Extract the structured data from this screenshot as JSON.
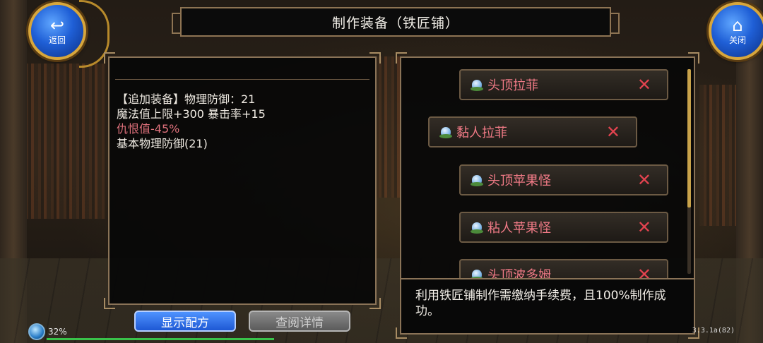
{
  "header": {
    "back_label": "返回",
    "close_label": "关闭",
    "title": "制作装备（铁匠铺）"
  },
  "equipment_stats": {
    "line1": "【追加装备】物理防御：21",
    "line2": "魔法值上限+300 暴击率+15",
    "line3": "仇恨值-45%",
    "line4": "基本物理防御(21)"
  },
  "materials": [
    {
      "name": "头顶拉菲",
      "remove": "✕"
    },
    {
      "name": "黏人拉菲",
      "remove": "✕"
    },
    {
      "name": "头顶苹果怪",
      "remove": "✕"
    },
    {
      "name": "粘人苹果怪",
      "remove": "✕"
    },
    {
      "name": "头顶波多姆",
      "remove": "✕"
    }
  ],
  "note": "利用铁匠铺制作需缴纳手续费，且100%制作成功。",
  "buttons": {
    "show_recipe": "显示配方",
    "view_details": "查阅详情"
  },
  "status": {
    "percent": "32%",
    "version": "3.3.1a(82)"
  },
  "colors": {
    "accent_blue": "#1e58d4",
    "penalty_red": "#e0717c",
    "item_red": "#f07a86",
    "frame_gold": "#8a7357"
  },
  "icons": {
    "back": "back-arrow-icon",
    "close": "home-icon",
    "material": "creature-icon",
    "remove": "close-icon"
  }
}
